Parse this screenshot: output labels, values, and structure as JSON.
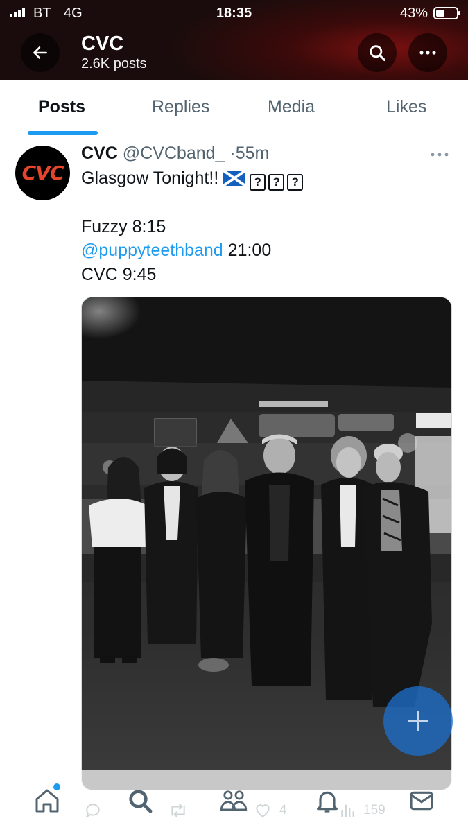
{
  "status_bar": {
    "carrier": "BT",
    "network": "4G",
    "time": "18:35",
    "battery_percent": "43%",
    "battery_level": 0.43
  },
  "header": {
    "title": "CVC",
    "post_count": "2.6K posts",
    "back_icon": "arrow-left-icon",
    "search_icon": "search-icon",
    "more_icon": "more-horizontal-icon"
  },
  "tabs": [
    {
      "label": "Posts",
      "active": true
    },
    {
      "label": "Replies",
      "active": false
    },
    {
      "label": "Media",
      "active": false
    },
    {
      "label": "Likes",
      "active": false
    }
  ],
  "tweet": {
    "avatar_text": "CVC",
    "display_name": "CVC",
    "handle": "@CVCband_",
    "separator": "·",
    "time": "55m",
    "line1": "Glasgow Tonight!!",
    "unknown_glyph": "?",
    "line2": "Fuzzy 8:15",
    "line3_mention": "@puppyteethband",
    "line3_rest": " 21:00",
    "line4": "CVC 9:45",
    "likes": "4",
    "views": "159"
  },
  "colors": {
    "accent": "#1d9bf0",
    "text_primary": "#0f1419",
    "text_secondary": "#536471",
    "header_red": "#7a1010",
    "avatar_orange": "#e5452a"
  },
  "bottom_nav": [
    "home-icon",
    "search-icon",
    "communities-icon",
    "notifications-icon",
    "messages-icon"
  ],
  "fab_icon": "plus-icon"
}
